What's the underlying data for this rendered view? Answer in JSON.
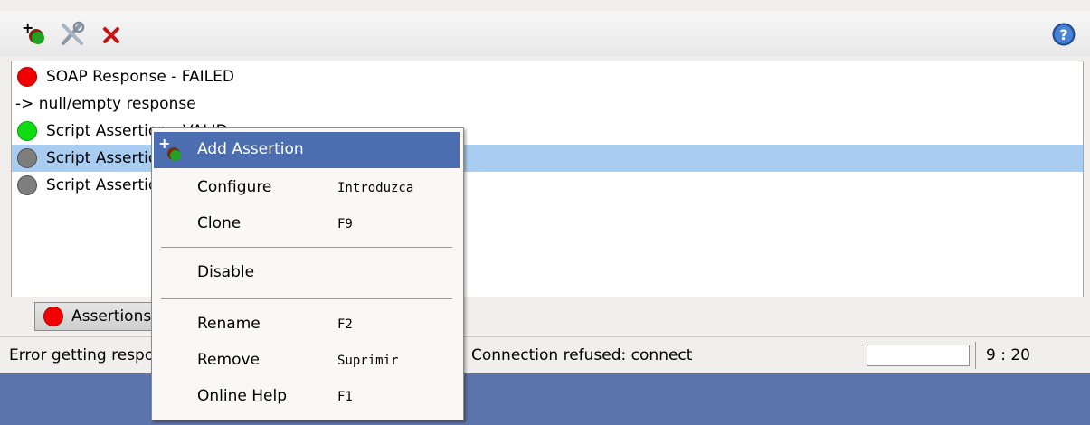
{
  "toolbar": {
    "add_icon": "add-assertion-icon",
    "configure_icon": "configure-tools-icon",
    "remove_icon": "remove-x-icon",
    "help_icon": "help-icon"
  },
  "assertions": [
    {
      "status": "red",
      "text": "SOAP Response - FAILED"
    },
    {
      "status": "none",
      "text": "-> null/empty response"
    },
    {
      "status": "green",
      "text": "Script Assertion - VALID"
    },
    {
      "status": "grey",
      "text": "Script Assertion"
    },
    {
      "status": "grey",
      "text": "Script Assertion"
    }
  ],
  "tab": {
    "label": "Assertions",
    "status": "red"
  },
  "status_bar": {
    "left_text": "Error getting response",
    "middle_text": "Connection refused: connect",
    "caret_position": "9 : 20"
  },
  "context_menu": {
    "items": [
      {
        "label": "Add Assertion",
        "accel": "",
        "highlighted": true
      },
      {
        "label": "Configure",
        "accel": "Introduzca"
      },
      {
        "label": "Clone",
        "accel": "F9"
      },
      {
        "label": "Disable",
        "accel": ""
      },
      {
        "label": "Rename",
        "accel": "F2"
      },
      {
        "label": "Remove",
        "accel": "Suprimir"
      },
      {
        "label": "Online Help",
        "accel": "F1"
      }
    ]
  },
  "colors": {
    "background": "#5b74ab",
    "selection": "#a8cdf1",
    "menu_highlight": "#4c6eb0",
    "status_failed": "#f00000",
    "status_valid": "#10dd10",
    "status_unknown": "#7e7e7e"
  }
}
